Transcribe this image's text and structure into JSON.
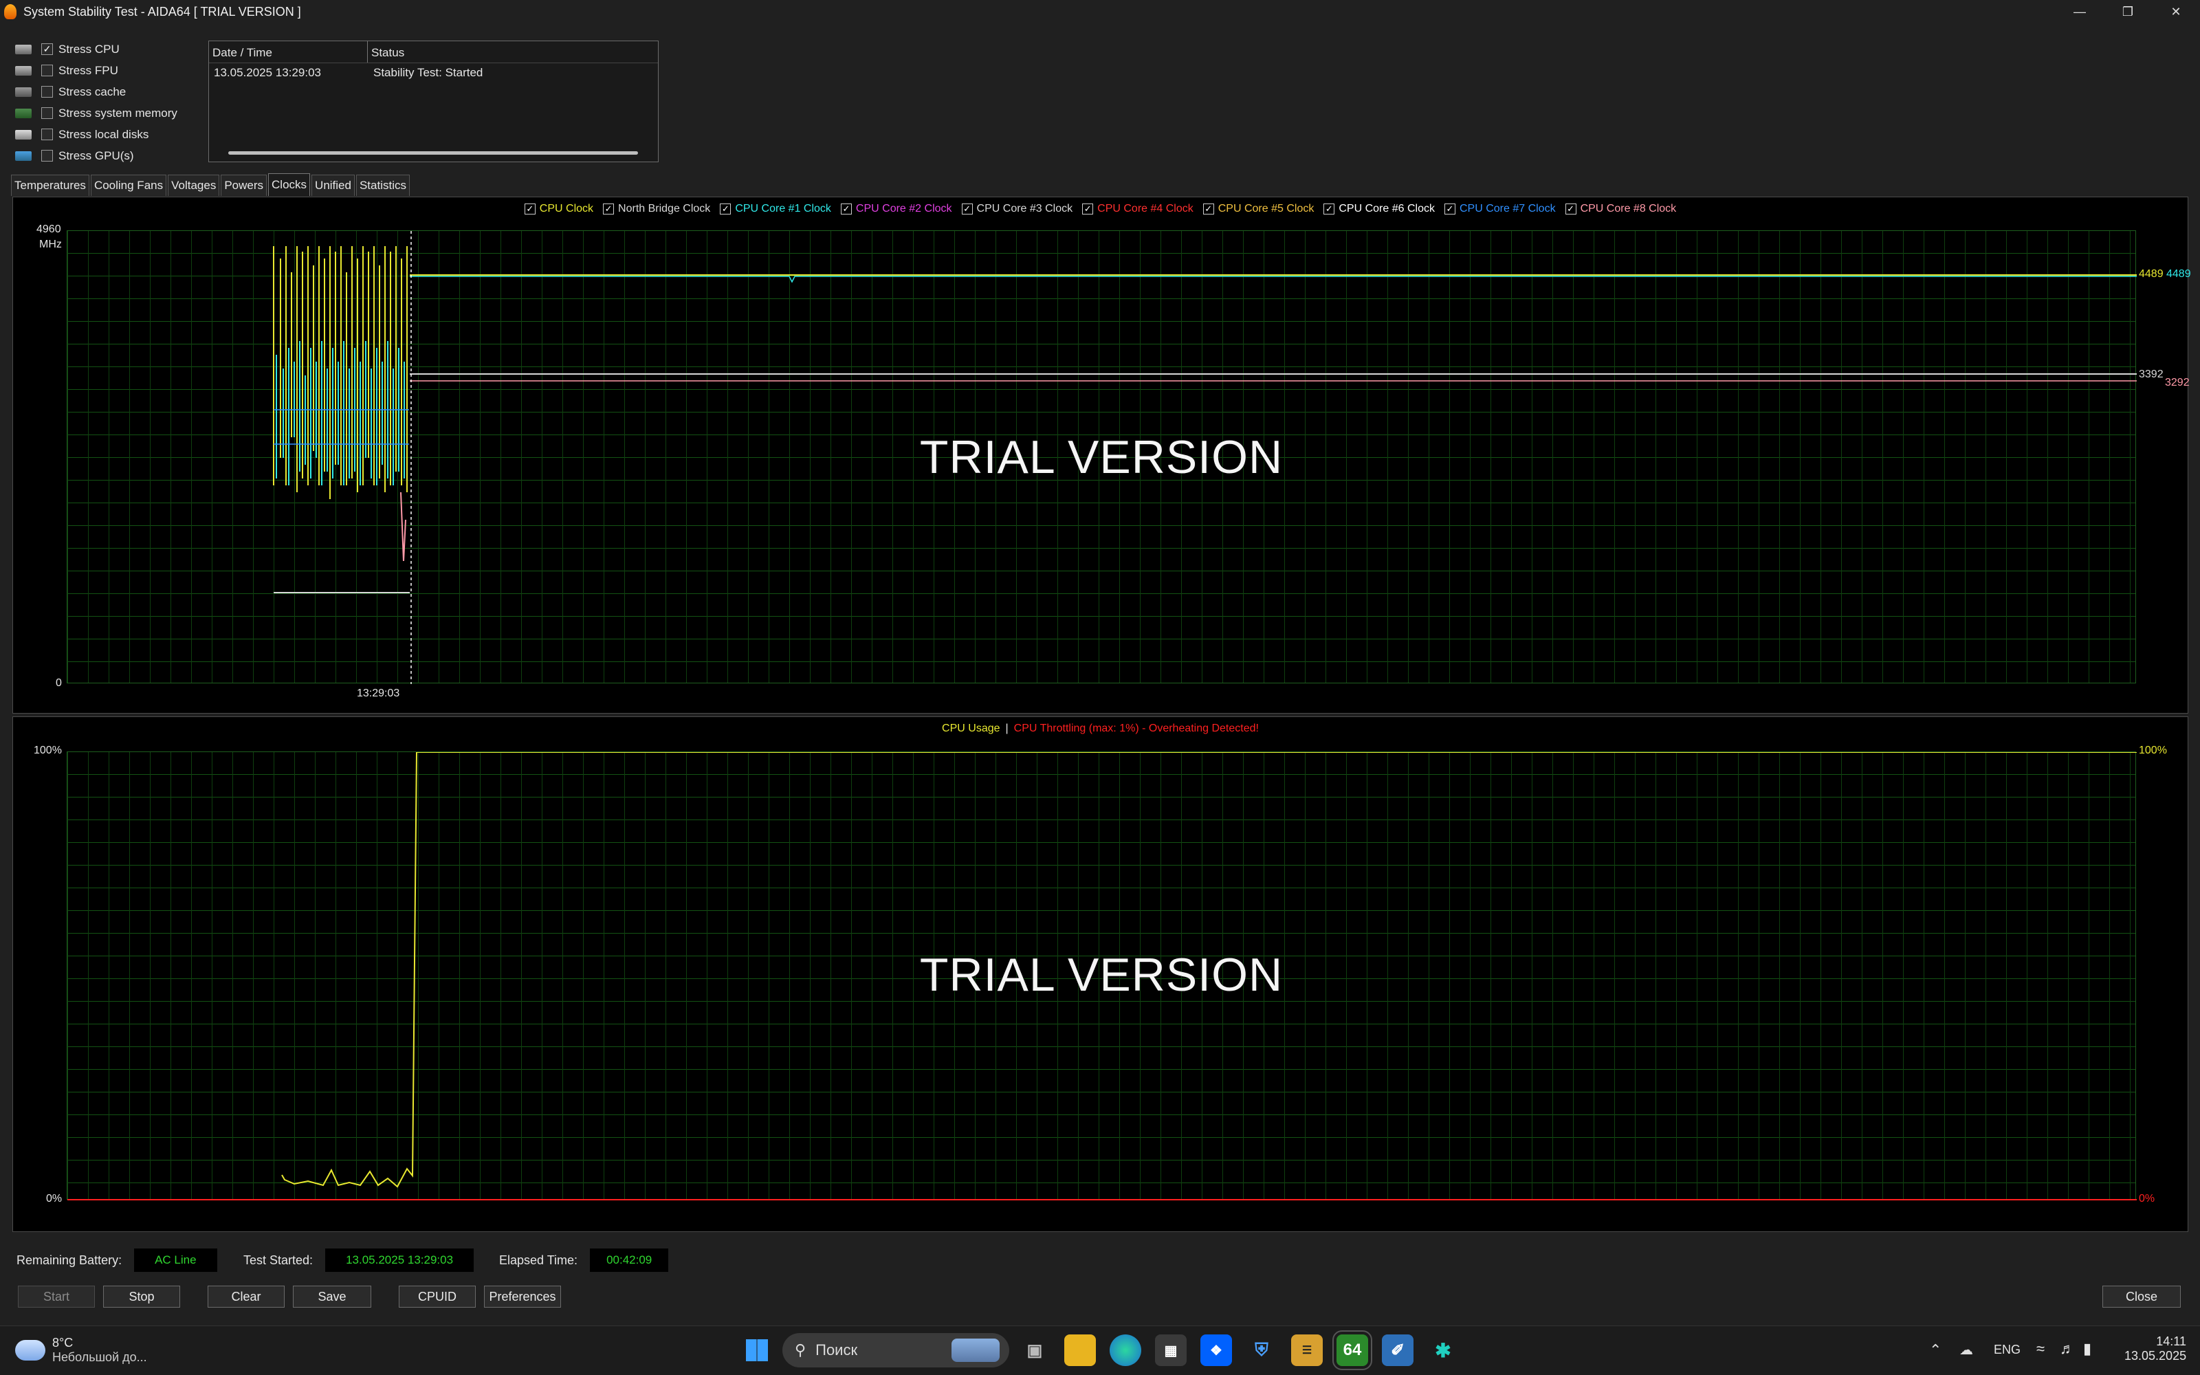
{
  "window": {
    "title": "System Stability Test - AIDA64  [ TRIAL VERSION ]"
  },
  "stress_options": [
    {
      "label": "Stress CPU",
      "checked": true,
      "icon": "cpu-icon"
    },
    {
      "label": "Stress FPU",
      "checked": false,
      "icon": "fpu-icon"
    },
    {
      "label": "Stress cache",
      "checked": false,
      "icon": "cache-icon"
    },
    {
      "label": "Stress system memory",
      "checked": false,
      "icon": "memory-icon"
    },
    {
      "label": "Stress local disks",
      "checked": false,
      "icon": "disk-icon"
    },
    {
      "label": "Stress GPU(s)",
      "checked": false,
      "icon": "gpu-icon"
    }
  ],
  "log": {
    "headers": [
      "Date / Time",
      "Status"
    ],
    "rows": [
      [
        "13.05.2025 13:29:03",
        "Stability Test: Started"
      ]
    ]
  },
  "tabs": [
    "Temperatures",
    "Cooling Fans",
    "Voltages",
    "Powers",
    "Clocks",
    "Unified",
    "Statistics"
  ],
  "active_tab": "Clocks",
  "clock_graph": {
    "legend": [
      {
        "label": "CPU Clock",
        "color": "#e8e830"
      },
      {
        "label": "North Bridge Clock",
        "color": "#d8d8d8"
      },
      {
        "label": "CPU Core #1 Clock",
        "color": "#30e8e8"
      },
      {
        "label": "CPU Core #2 Clock",
        "color": "#e040e0"
      },
      {
        "label": "CPU Core #3 Clock",
        "color": "#d8d8d8"
      },
      {
        "label": "CPU Core #4 Clock",
        "color": "#ff3030"
      },
      {
        "label": "CPU Core #5 Clock",
        "color": "#f0c040"
      },
      {
        "label": "CPU Core #6 Clock",
        "color": "#ffffff"
      },
      {
        "label": "CPU Core #7 Clock",
        "color": "#3090ff"
      },
      {
        "label": "CPU Core #8 Clock",
        "color": "#ff9aa8"
      }
    ],
    "y_max": "4960",
    "y_unit": "MHz",
    "y_min": "0",
    "time_label": "13:29:03",
    "right_labels": [
      {
        "text": "4489",
        "color": "#e8e830"
      },
      {
        "text": "4489",
        "color": "#30e8e8"
      },
      {
        "text": "3392",
        "color": "#d8d8d8"
      },
      {
        "text": "3292",
        "color": "#ff9aa8"
      }
    ],
    "watermark": "TRIAL VERSION"
  },
  "usage_graph": {
    "title_usage": "CPU Usage",
    "separator": "|",
    "title_throttle": "CPU Throttling (max: 1%) - Overheating Detected!",
    "usage_color": "#e8e830",
    "throttle_color": "#ff2020",
    "y_max": "100%",
    "y_min": "0%",
    "right_top": "100%",
    "right_bottom": "0%",
    "watermark": "TRIAL VERSION"
  },
  "status": {
    "battery_label": "Remaining Battery:",
    "battery_value": "AC Line",
    "started_label": "Test Started:",
    "started_value": "13.05.2025 13:29:03",
    "elapsed_label": "Elapsed Time:",
    "elapsed_value": "00:42:09"
  },
  "buttons": {
    "start": "Start",
    "stop": "Stop",
    "clear": "Clear",
    "save": "Save",
    "cpuid": "CPUID",
    "preferences": "Preferences",
    "close": "Close"
  },
  "taskbar": {
    "weather_temp": "8°C",
    "weather_desc": "Небольшой до...",
    "search_placeholder": "Поиск",
    "language": "ENG",
    "time": "14:11",
    "date": "13.05.2025",
    "aida_label": "64"
  }
}
